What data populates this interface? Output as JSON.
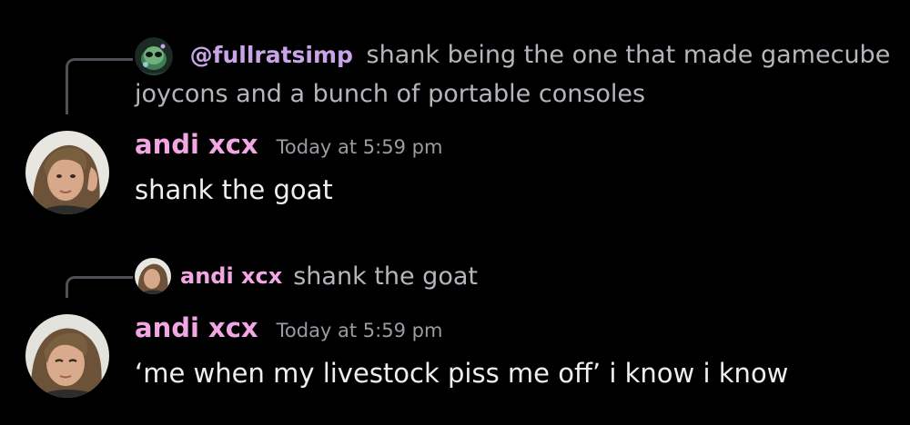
{
  "messages": [
    {
      "reply": {
        "avatar_icon": "green-alien-avatar-icon",
        "mention": "@fullratsimp",
        "text": "shank being the one that made gamecube joycons and a bunch of portable consoles"
      },
      "author": "andi xcx",
      "timestamp": "Today at 5:59 pm",
      "content": "shank the goat",
      "avatar_icon": "user-photo-avatar-icon"
    },
    {
      "reply": {
        "avatar_icon": "user-photo-avatar-icon",
        "author": "andi xcx",
        "text": "shank the goat"
      },
      "author": "andi xcx",
      "timestamp": "Today at 5:59 pm",
      "content": "‘me when my livestock piss me off’ i know i know",
      "avatar_icon": "user-photo-avatar-icon"
    }
  ],
  "colors": {
    "background": "#000000",
    "author": "#f2a6e4",
    "mention": "#c9a4e8",
    "reply_text": "#b5b6bc",
    "timestamp": "#9a9ba3",
    "spine": "#4e5058"
  }
}
